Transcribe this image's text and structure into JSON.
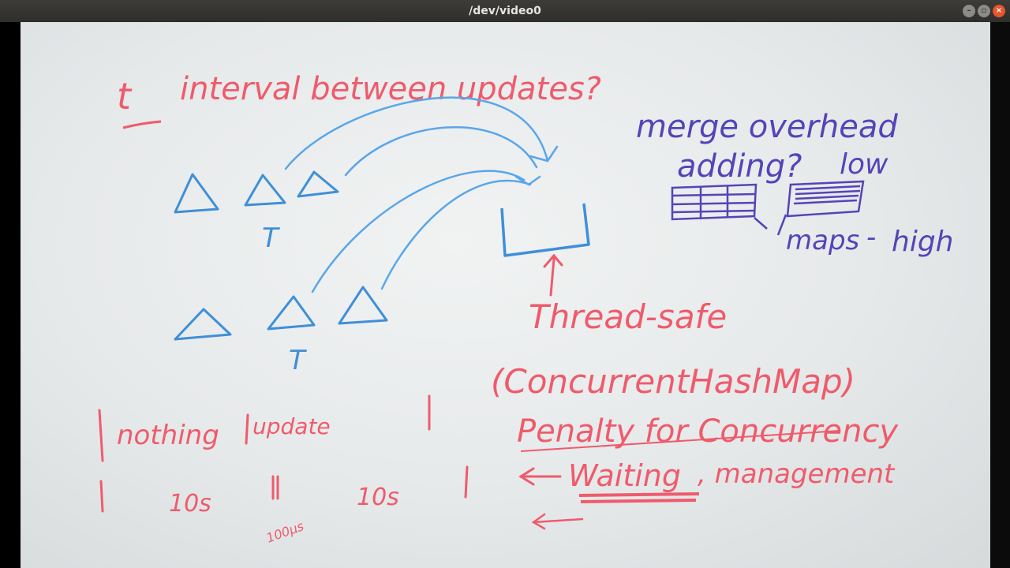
{
  "window": {
    "title": "/dev/video0",
    "buttons": {
      "minimize": "–",
      "maximize": "▫",
      "close": "×"
    }
  },
  "board": {
    "heading_prefix": "t",
    "heading": "interval between updates?",
    "merge_line1": "merge overhead",
    "merge_line2": "adding?",
    "merge_low": "low",
    "maps": "maps",
    "maps_dash": "-",
    "maps_high": "high",
    "t_upper": "T",
    "t_lower": "T",
    "thread_safe": "Thread-safe",
    "concurrent": "(ConcurrentHashMap)",
    "penalty": "Penalty for Concurrency",
    "waiting": "Waiting",
    "management": ", management",
    "timeline_nothing": "nothing",
    "timeline_update": "update",
    "timeline_10s_a": "10s",
    "timeline_10s_b": "10s",
    "timeline_small": "100µs"
  },
  "colors": {
    "blue_ink": "#3f8fd8",
    "red_ink": "#ef5b6b",
    "purple_ink": "#5643b8",
    "whiteboard": "#eceff0"
  }
}
